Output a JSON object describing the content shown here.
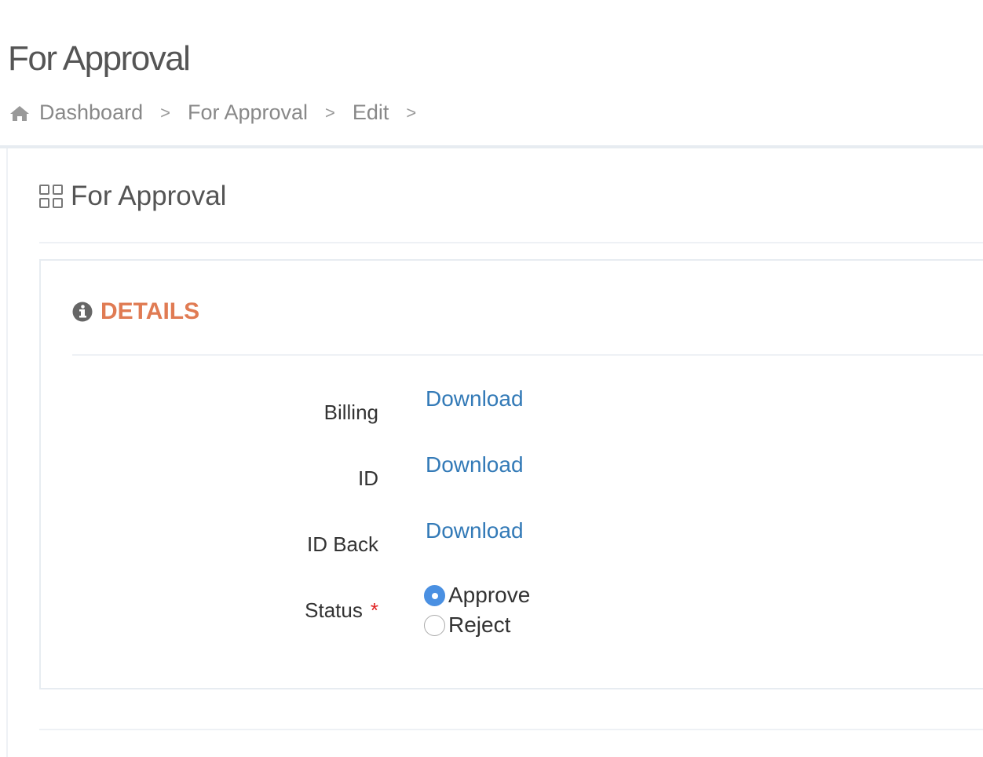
{
  "page_title": "For Approval",
  "breadcrumb": [
    "Dashboard",
    "For Approval",
    "Edit"
  ],
  "portlet_title": "For Approval",
  "section": {
    "title": "DETAILS"
  },
  "fields": [
    {
      "label": "Billing",
      "link": "Download"
    },
    {
      "label": "ID",
      "link": "Download"
    },
    {
      "label": "ID Back",
      "link": "Download"
    }
  ],
  "status": {
    "label": "Status",
    "required": "*",
    "options": [
      "Approve",
      "Reject"
    ],
    "selected": "Approve"
  },
  "colors": {
    "accent": "#e07b53",
    "link": "#337ab7",
    "radio": "#4a90e2"
  }
}
